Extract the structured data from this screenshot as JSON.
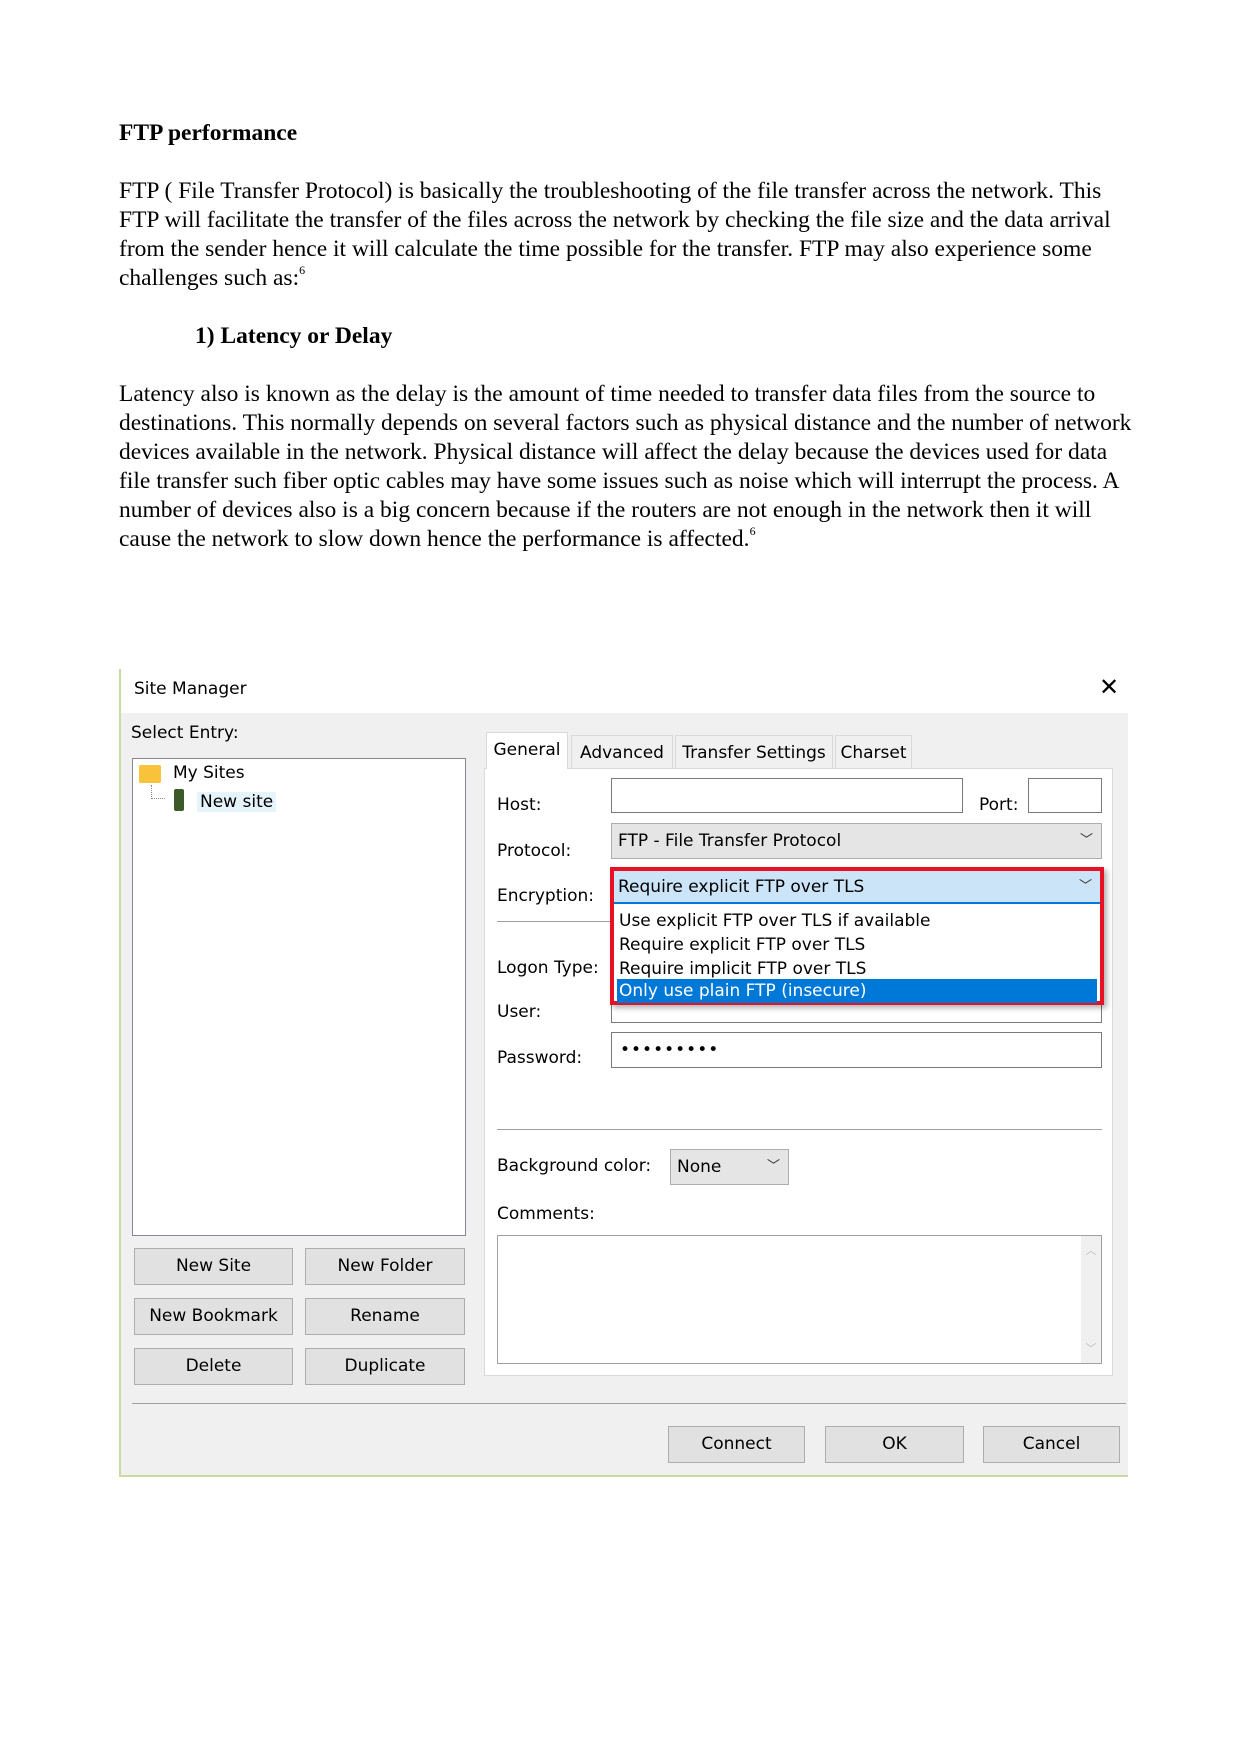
{
  "document": {
    "heading": "FTP performance",
    "para1": "FTP ( File Transfer Protocol)  is basically the troubleshooting of the file transfer across the network. This FTP will facilitate the transfer of the files across the network by checking the file size and the data arrival from the sender hence it will calculate the time possible for the transfer. FTP may also experience some challenges such as:",
    "para1_ref": "6",
    "subheading": "1) Latency or Delay",
    "para2": "Latency also is known as the delay is the amount of time needed to transfer data files from the source to destinations. This normally depends on several factors such as physical distance and the number of network devices available in the network. Physical distance will affect the delay because the devices used for data file transfer such fiber optic cables may have some issues such as noise which will interrupt the process. A number of devices also is a big concern because if the routers are not enough in the network then it will cause the network to slow down hence the performance is affected.",
    "para2_ref": "6"
  },
  "dialog": {
    "title": "Site Manager",
    "select_entry": "Select Entry:",
    "tree": {
      "root": "My Sites",
      "child": "New site"
    },
    "buttons": {
      "new_site": "New Site",
      "new_folder": "New Folder",
      "new_bookmark": "New Bookmark",
      "rename": "Rename",
      "delete": "Delete",
      "duplicate": "Duplicate",
      "connect": "Connect",
      "ok": "OK",
      "cancel": "Cancel"
    },
    "tabs": [
      "General",
      "Advanced",
      "Transfer Settings",
      "Charset"
    ],
    "labels": {
      "host": "Host:",
      "port": "Port:",
      "protocol": "Protocol:",
      "encryption": "Encryption:",
      "logon_type": "Logon Type:",
      "user": "User:",
      "password": "Password:",
      "background_color": "Background color:",
      "comments": "Comments:"
    },
    "values": {
      "host": "",
      "port": "",
      "protocol": "FTP - File Transfer Protocol",
      "encryption": "Require explicit FTP over TLS",
      "password": "•••••••••",
      "background_color": "None"
    },
    "encryption_options": [
      "Use explicit FTP over TLS if available",
      "Require explicit FTP over TLS",
      "Require implicit FTP over TLS",
      "Only use plain FTP (insecure)"
    ],
    "highlight_color": "#e81123",
    "selected_color": "#0078d7"
  }
}
